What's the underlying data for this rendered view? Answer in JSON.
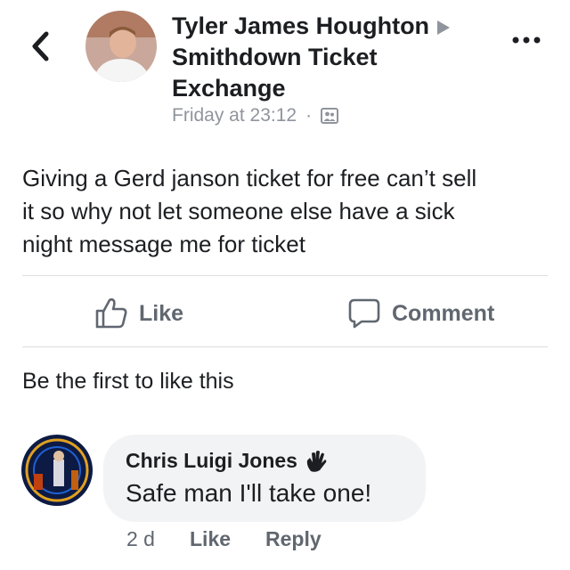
{
  "header": {
    "author_name": "Tyler James Houghton",
    "group_name_line1": "Smithdown Ticket",
    "group_name_line2": "Exchange",
    "timestamp": "Friday at 23:12",
    "separator": "·",
    "privacy_icon": "group-members-icon"
  },
  "post": {
    "text_line1": "Giving a Gerd janson ticket for free can’t sell",
    "text_line2": "it so why not let someone else have a sick",
    "text_line3": "night message me for ticket"
  },
  "actions": {
    "like_label": "Like",
    "comment_label": "Comment"
  },
  "reactions_summary": "Be the first to like this",
  "comment": {
    "author": "Chris Luigi Jones",
    "badge_icon": "waving-hand-icon",
    "text": "Safe man I'll take one!",
    "age": "2 d",
    "like_label": "Like",
    "reply_label": "Reply"
  },
  "colors": {
    "text": "#1c1e21",
    "secondary": "#90949c",
    "action_gray": "#606770",
    "bubble": "#f2f3f5"
  }
}
